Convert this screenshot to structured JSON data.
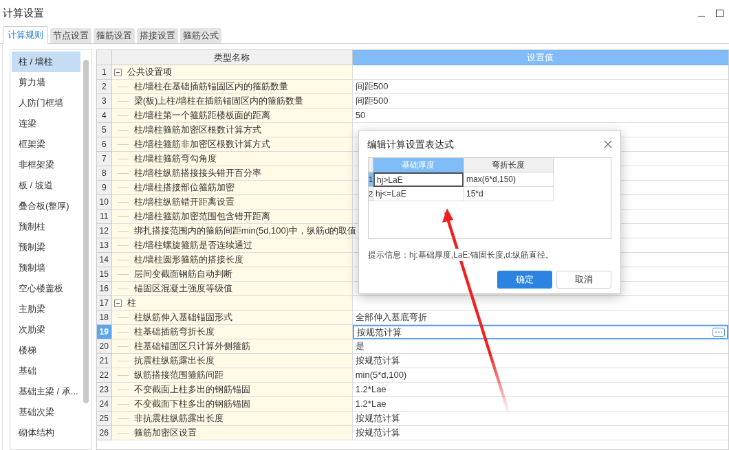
{
  "window": {
    "title": "计算设置"
  },
  "tabs": [
    {
      "label": "计算规则",
      "selected": true
    },
    {
      "label": "节点设置",
      "selected": false
    },
    {
      "label": "箍筋设置",
      "selected": false
    },
    {
      "label": "搭接设置",
      "selected": false
    },
    {
      "label": "箍筋公式",
      "selected": false
    }
  ],
  "sidebar": {
    "items": [
      {
        "label": "柱 / 墙柱",
        "selected": true
      },
      {
        "label": "剪力墙",
        "selected": false
      },
      {
        "label": "人防门框墙",
        "selected": false
      },
      {
        "label": "连梁",
        "selected": false
      },
      {
        "label": "框架梁",
        "selected": false
      },
      {
        "label": "非框架梁",
        "selected": false
      },
      {
        "label": "板 / 坡道",
        "selected": false
      },
      {
        "label": "叠合板(整厚)",
        "selected": false
      },
      {
        "label": "预制柱",
        "selected": false
      },
      {
        "label": "预制梁",
        "selected": false
      },
      {
        "label": "预制墙",
        "selected": false
      },
      {
        "label": "空心楼盖板",
        "selected": false
      },
      {
        "label": "主肋梁",
        "selected": false
      },
      {
        "label": "次肋梁",
        "selected": false
      },
      {
        "label": "楼梯",
        "selected": false
      },
      {
        "label": "基础",
        "selected": false
      },
      {
        "label": "基础主梁 / 承...",
        "selected": false
      },
      {
        "label": "基础次梁",
        "selected": false
      },
      {
        "label": "砌体结构",
        "selected": false
      }
    ]
  },
  "table": {
    "columns": [
      "类型名称",
      "设置值"
    ],
    "rows": [
      {
        "number": "1",
        "name": "公共设置项",
        "expanded": true,
        "selected": false,
        "children": [
          {
            "number": "2",
            "name": "柱/墙柱在基础插筋锚固区内的箍筋数量",
            "value": "间距500",
            "selected": false
          },
          {
            "number": "3",
            "name": "梁(板)上柱/墙柱在插筋锚固区内的箍筋数量",
            "value": "间距500",
            "selected": false
          },
          {
            "number": "4",
            "name": "柱/墙柱第一个箍筋距楼板面的距离",
            "value": "50",
            "selected": false
          },
          {
            "number": "5",
            "name": "柱/墙柱箍筋加密区根数计算方式",
            "selected": false
          },
          {
            "number": "6",
            "name": "柱/墙柱箍筋非加密区根数计算方式",
            "selected": false
          },
          {
            "number": "7",
            "name": "柱/墙柱箍筋弯勾角度",
            "selected": false
          },
          {
            "number": "8",
            "name": "柱/墙柱纵筋搭接接头错开百分率",
            "selected": false
          },
          {
            "number": "9",
            "name": "柱/墙柱搭接部位箍筋加密",
            "selected": false
          },
          {
            "number": "10",
            "name": "柱/墙柱纵筋错开距离设置",
            "selected": false
          },
          {
            "number": "11",
            "name": "柱/墙柱箍筋加密范围包含错开距离",
            "selected": false
          },
          {
            "number": "12",
            "name": "绑扎搭接范围内的箍筋间距min(5d,100)中，纵筋d的取值",
            "selected": false
          },
          {
            "number": "13",
            "name": "柱/墙柱螺旋箍筋是否连续通过",
            "selected": false
          },
          {
            "number": "14",
            "name": "柱/墙柱圆形箍筋的搭接长度",
            "selected": false
          },
          {
            "number": "15",
            "name": "层间变截面钢筋自动判断",
            "selected": false
          },
          {
            "number": "16",
            "name": "锚固区混凝土强度等级值",
            "selected": false
          }
        ]
      },
      {
        "number": "17",
        "name": "柱",
        "expanded": true,
        "selected": false,
        "children": [
          {
            "number": "18",
            "name": "柱纵筋伸入基础锚固形式",
            "value": "全部伸入基底弯折",
            "selected": false
          },
          {
            "number": "19",
            "name": "柱基础插筋弯折长度",
            "value": "按规范计算",
            "selected": true
          },
          {
            "number": "20",
            "name": "柱基础锚固区只计算外侧箍筋",
            "value": "是",
            "selected": false
          },
          {
            "number": "21",
            "name": "抗震柱纵筋露出长度",
            "value": "按规范计算",
            "selected": false
          },
          {
            "number": "22",
            "name": "纵筋搭接范围箍筋间距",
            "value": "min(5*d,100)",
            "selected": false
          },
          {
            "number": "23",
            "name": "不变截面上柱多出的钢筋锚固",
            "value": "1.2*Lae",
            "selected": false
          },
          {
            "number": "24",
            "name": "不变截面下柱多出的钢筋锚固",
            "value": "1.2*Lae",
            "selected": false
          },
          {
            "number": "25",
            "name": "非抗震柱纵筋露出长度",
            "value": "按规范计算",
            "selected": false
          },
          {
            "number": "26",
            "name": "箍筋加密区设置",
            "value": "按规范计算",
            "selected": false
          }
        ]
      }
    ]
  },
  "dialog": {
    "title": "编辑计算设置表达式",
    "columns": [
      {
        "label": "基础厚度",
        "selected": true
      },
      {
        "label": "弯折长度",
        "selected": false
      }
    ],
    "rows": [
      {
        "number": "1",
        "condition": "hj>LaE",
        "value": "max(6*d,150)",
        "selected": true
      },
      {
        "number": "2",
        "condition": "hj<=LaE",
        "value": "15*d",
        "selected": false
      }
    ],
    "hint": "提示信息：hj:基础厚度,LaE:锚固长度,d:纵筋直径。",
    "buttons": [
      {
        "label": "确定",
        "kind": "primary"
      },
      {
        "label": "取消",
        "kind": "secondary"
      }
    ]
  }
}
